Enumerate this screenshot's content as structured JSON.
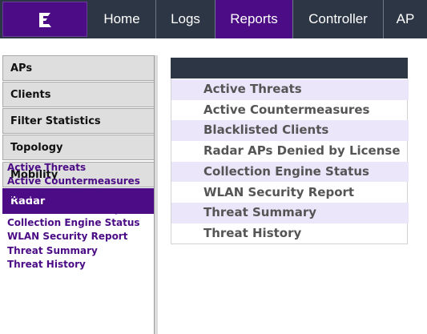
{
  "nav": {
    "logo_icon": "extreme-networks-logo-icon",
    "tabs": [
      {
        "label": "Home"
      },
      {
        "label": "Logs"
      },
      {
        "label": "Reports"
      },
      {
        "label": "Controller"
      },
      {
        "label": "AP"
      }
    ],
    "active_tab": "Reports"
  },
  "sidebar": {
    "items": [
      {
        "label": "APs"
      },
      {
        "label": "Clients"
      },
      {
        "label": "Filter Statistics"
      },
      {
        "label": "Topology"
      },
      {
        "label": "Mobility"
      },
      {
        "label": "Radar"
      }
    ],
    "active_item": "Radar",
    "sub_items": [
      {
        "label": "Active Threats"
      },
      {
        "label": "Active Countermeasures"
      },
      {
        "label": "Blacklisted Clients"
      },
      {
        "label": "Radar APs Denied by License"
      },
      {
        "label": "Collection Engine Status"
      },
      {
        "label": "WLAN Security Report"
      },
      {
        "label": "Threat Summary"
      },
      {
        "label": "Threat History"
      }
    ]
  },
  "main": {
    "reports": [
      {
        "label": "Active Threats"
      },
      {
        "label": "Active Countermeasures"
      },
      {
        "label": "Blacklisted Clients"
      },
      {
        "label": "Radar APs Denied by License"
      },
      {
        "label": "Collection Engine Status"
      },
      {
        "label": "WLAN Security Report"
      },
      {
        "label": "Threat Summary"
      },
      {
        "label": "Threat History"
      }
    ]
  },
  "colors": {
    "accent": "#4b0c85",
    "nav_bg": "#2d3645",
    "row_shade": "#ece6fa"
  }
}
